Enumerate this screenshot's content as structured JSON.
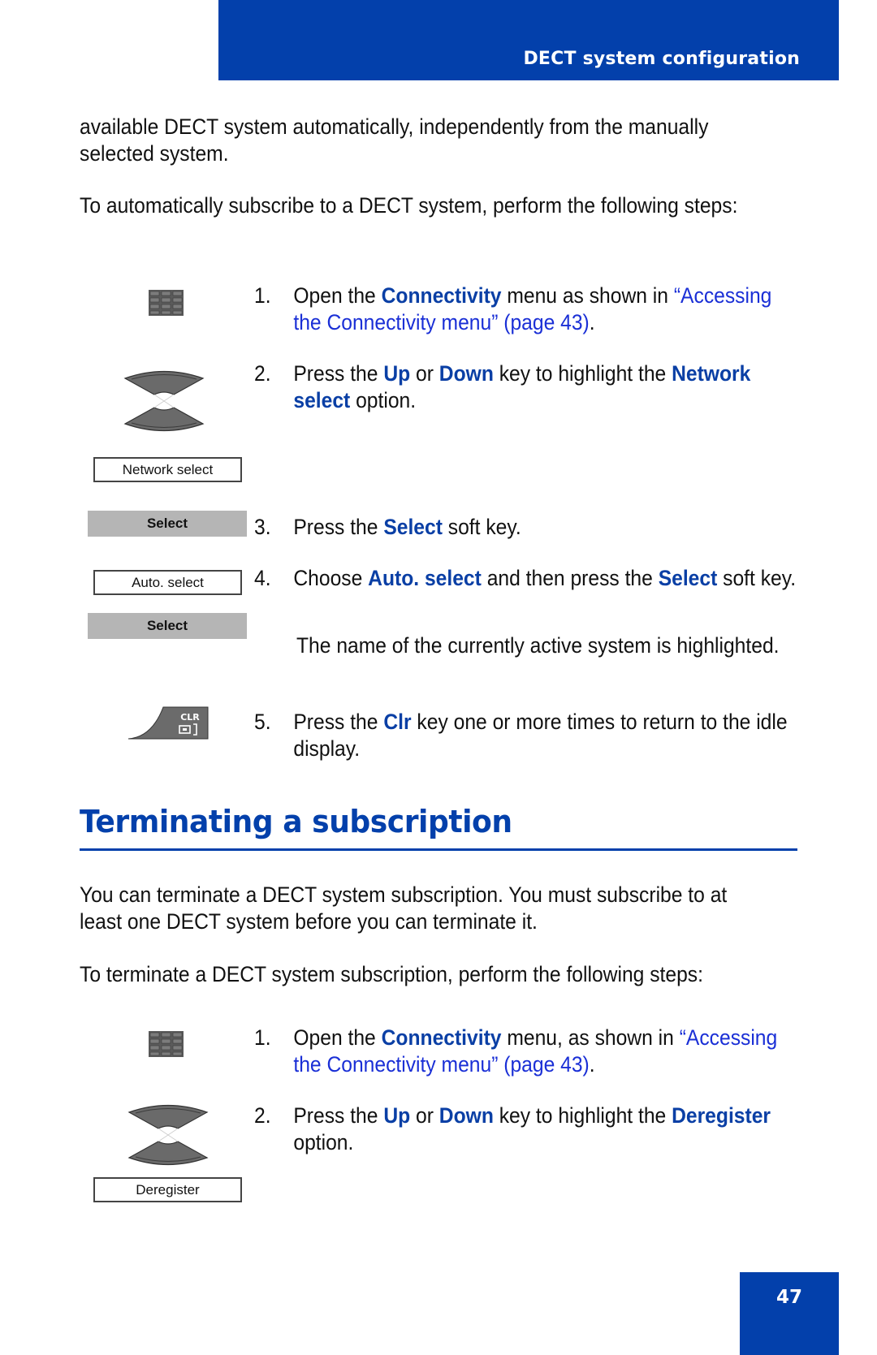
{
  "header": {
    "section_title": "DECT system configuration"
  },
  "intro": {
    "para1": "available DECT system automatically, independently from the manually selected system.",
    "para2": "To automatically subscribe to a DECT system, perform the following steps:"
  },
  "auto_steps": [
    {
      "num": "1.",
      "pre": "Open the ",
      "kw1": "Connectivity",
      "mid": " menu as shown in ",
      "link": "“Accessing the Connectivity menu” (page 43)",
      "post": "."
    },
    {
      "num": "2.",
      "pre": "Press the ",
      "kw1": "Up",
      "mid1": " or ",
      "kw2": "Down",
      "mid2": " key to highlight the ",
      "kw3": "Network select",
      "post": " option."
    },
    {
      "num": "3.",
      "pre": "Press the ",
      "kw1": "Select",
      "post": " soft key."
    },
    {
      "num": "4.",
      "pre": "Choose ",
      "kw1": "Auto. select",
      "mid": " and then press the ",
      "kw2": "Select",
      "post": " soft key.",
      "note": "The name of the currently active system is highlighted."
    },
    {
      "num": "5.",
      "pre": "Press the ",
      "kw1": "Clr",
      "post": " key one or more times to return to the idle display."
    }
  ],
  "icons": {
    "display_network_select": "Network select",
    "softkey_select_1": "Select",
    "display_auto_select": "Auto. select",
    "softkey_select_2": "Select",
    "clr_key_label": "CLR",
    "display_deregister": "Deregister"
  },
  "section": {
    "heading": "Terminating a subscription",
    "para1": "You can terminate a DECT system subscription. You must subscribe to at least one DECT system before you can terminate it.",
    "para2": "To terminate a DECT system subscription, perform the following steps:"
  },
  "term_steps": [
    {
      "num": "1.",
      "pre": "Open the ",
      "kw1": "Connectivity",
      "mid": " menu, as shown in ",
      "link": "“Accessing the Connectivity menu” (page 43)",
      "post": "."
    },
    {
      "num": "2.",
      "pre": "Press the ",
      "kw1": "Up",
      "mid1": " or ",
      "kw2": "Down",
      "mid2": " key to highlight the ",
      "kw3": "Deregister",
      "post": " option."
    }
  ],
  "footer": {
    "page_number": "47"
  },
  "colors": {
    "brand_blue": "#0340AB",
    "link_blue": "#1a2fd6",
    "softkey_gray": "#b5b5b5"
  }
}
